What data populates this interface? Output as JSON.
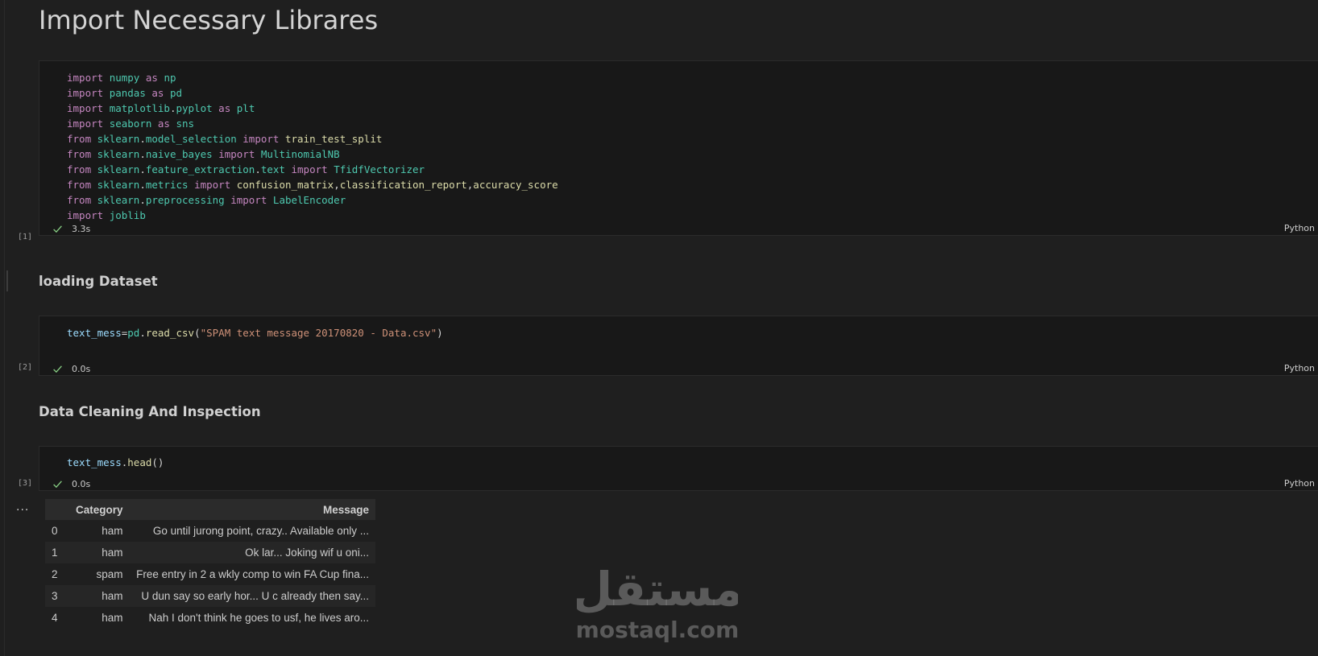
{
  "headings": {
    "import_libraries": "Import Necessary Librares",
    "loading_dataset": "loading Dataset",
    "data_cleaning": "Data Cleaning And Inspection"
  },
  "cells": {
    "cell1": {
      "exec_count": "[1]",
      "duration": "3.3s",
      "language": "Python"
    },
    "cell2": {
      "exec_count": "[2]",
      "duration": "0.0s",
      "language": "Python"
    },
    "cell3": {
      "exec_count": "[3]",
      "duration": "0.0s",
      "language": "Python"
    }
  },
  "code": {
    "cell1": [
      [
        [
          "kw",
          "import"
        ],
        [
          "pln",
          " "
        ],
        [
          "mod",
          "numpy"
        ],
        [
          "pln",
          " "
        ],
        [
          "kw",
          "as"
        ],
        [
          "pln",
          " "
        ],
        [
          "mod",
          "np"
        ]
      ],
      [
        [
          "kw",
          "import"
        ],
        [
          "pln",
          " "
        ],
        [
          "mod",
          "pandas"
        ],
        [
          "pln",
          " "
        ],
        [
          "kw",
          "as"
        ],
        [
          "pln",
          " "
        ],
        [
          "mod",
          "pd"
        ]
      ],
      [
        [
          "kw",
          "import"
        ],
        [
          "pln",
          " "
        ],
        [
          "mod",
          "matplotlib"
        ],
        [
          "pun",
          "."
        ],
        [
          "mod",
          "pyplot"
        ],
        [
          "pln",
          " "
        ],
        [
          "kw",
          "as"
        ],
        [
          "pln",
          " "
        ],
        [
          "mod",
          "plt"
        ]
      ],
      [
        [
          "kw",
          "import"
        ],
        [
          "pln",
          " "
        ],
        [
          "mod",
          "seaborn"
        ],
        [
          "pln",
          " "
        ],
        [
          "kw",
          "as"
        ],
        [
          "pln",
          " "
        ],
        [
          "mod",
          "sns"
        ]
      ],
      [
        [
          "kw",
          "from"
        ],
        [
          "pln",
          " "
        ],
        [
          "mod",
          "sklearn"
        ],
        [
          "pun",
          "."
        ],
        [
          "mod",
          "model_selection"
        ],
        [
          "pln",
          " "
        ],
        [
          "kw",
          "import"
        ],
        [
          "pln",
          " "
        ],
        [
          "fn",
          "train_test_split"
        ]
      ],
      [
        [
          "kw",
          "from"
        ],
        [
          "pln",
          " "
        ],
        [
          "mod",
          "sklearn"
        ],
        [
          "pun",
          "."
        ],
        [
          "mod",
          "naive_bayes"
        ],
        [
          "pln",
          " "
        ],
        [
          "kw",
          "import"
        ],
        [
          "pln",
          " "
        ],
        [
          "mod",
          "MultinomialNB"
        ]
      ],
      [
        [
          "kw",
          "from"
        ],
        [
          "pln",
          " "
        ],
        [
          "mod",
          "sklearn"
        ],
        [
          "pun",
          "."
        ],
        [
          "mod",
          "feature_extraction"
        ],
        [
          "pun",
          "."
        ],
        [
          "mod",
          "text"
        ],
        [
          "pln",
          " "
        ],
        [
          "kw",
          "import"
        ],
        [
          "pln",
          " "
        ],
        [
          "mod",
          "TfidfVectorizer"
        ]
      ],
      [
        [
          "kw",
          "from"
        ],
        [
          "pln",
          " "
        ],
        [
          "mod",
          "sklearn"
        ],
        [
          "pun",
          "."
        ],
        [
          "mod",
          "metrics"
        ],
        [
          "pln",
          " "
        ],
        [
          "kw",
          "import"
        ],
        [
          "pln",
          " "
        ],
        [
          "fn",
          "confusion_matrix"
        ],
        [
          "pun",
          ","
        ],
        [
          "fn",
          "classification_report"
        ],
        [
          "pun",
          ","
        ],
        [
          "fn",
          "accuracy_score"
        ]
      ],
      [
        [
          "kw",
          "from"
        ],
        [
          "pln",
          " "
        ],
        [
          "mod",
          "sklearn"
        ],
        [
          "pun",
          "."
        ],
        [
          "mod",
          "preprocessing"
        ],
        [
          "pln",
          " "
        ],
        [
          "kw",
          "import"
        ],
        [
          "pln",
          " "
        ],
        [
          "mod",
          "LabelEncoder"
        ]
      ],
      [
        [
          "kw",
          "import"
        ],
        [
          "pln",
          " "
        ],
        [
          "mod",
          "joblib"
        ]
      ]
    ],
    "cell2": [
      [
        [
          "var",
          "text_mess"
        ],
        [
          "pun",
          "="
        ],
        [
          "mod",
          "pd"
        ],
        [
          "pun",
          "."
        ],
        [
          "fn",
          "read_csv"
        ],
        [
          "pun",
          "("
        ],
        [
          "str",
          "\"SPAM text message 20170820 - Data.csv\""
        ],
        [
          "pun",
          ")"
        ]
      ]
    ],
    "cell3": [
      [
        [
          "var",
          "text_mess"
        ],
        [
          "pun",
          "."
        ],
        [
          "fn",
          "head"
        ],
        [
          "pun",
          "()"
        ]
      ]
    ]
  },
  "output": {
    "menu_label": "...",
    "table": {
      "columns": [
        "",
        "Category",
        "Message"
      ],
      "rows": [
        [
          "0",
          "ham",
          "Go until jurong point, crazy.. Available only ..."
        ],
        [
          "1",
          "ham",
          "Ok lar... Joking wif u oni..."
        ],
        [
          "2",
          "spam",
          "Free entry in 2 a wkly comp to win FA Cup fina..."
        ],
        [
          "3",
          "ham",
          "U dun say so early hor... U c already then say..."
        ],
        [
          "4",
          "ham",
          "Nah I don't think he goes to usf, he lives aro..."
        ]
      ]
    }
  },
  "watermark": {
    "arabic": "مستقل",
    "domain": "mostaql.com"
  },
  "colors": {
    "keyword": "#c586c0",
    "module": "#4ec9b0",
    "function": "#dcdcaa",
    "variable": "#9cdcfe",
    "string": "#ce9178",
    "success_check": "#89d185",
    "background": "#1f1f1f",
    "cell_background": "#181818"
  }
}
